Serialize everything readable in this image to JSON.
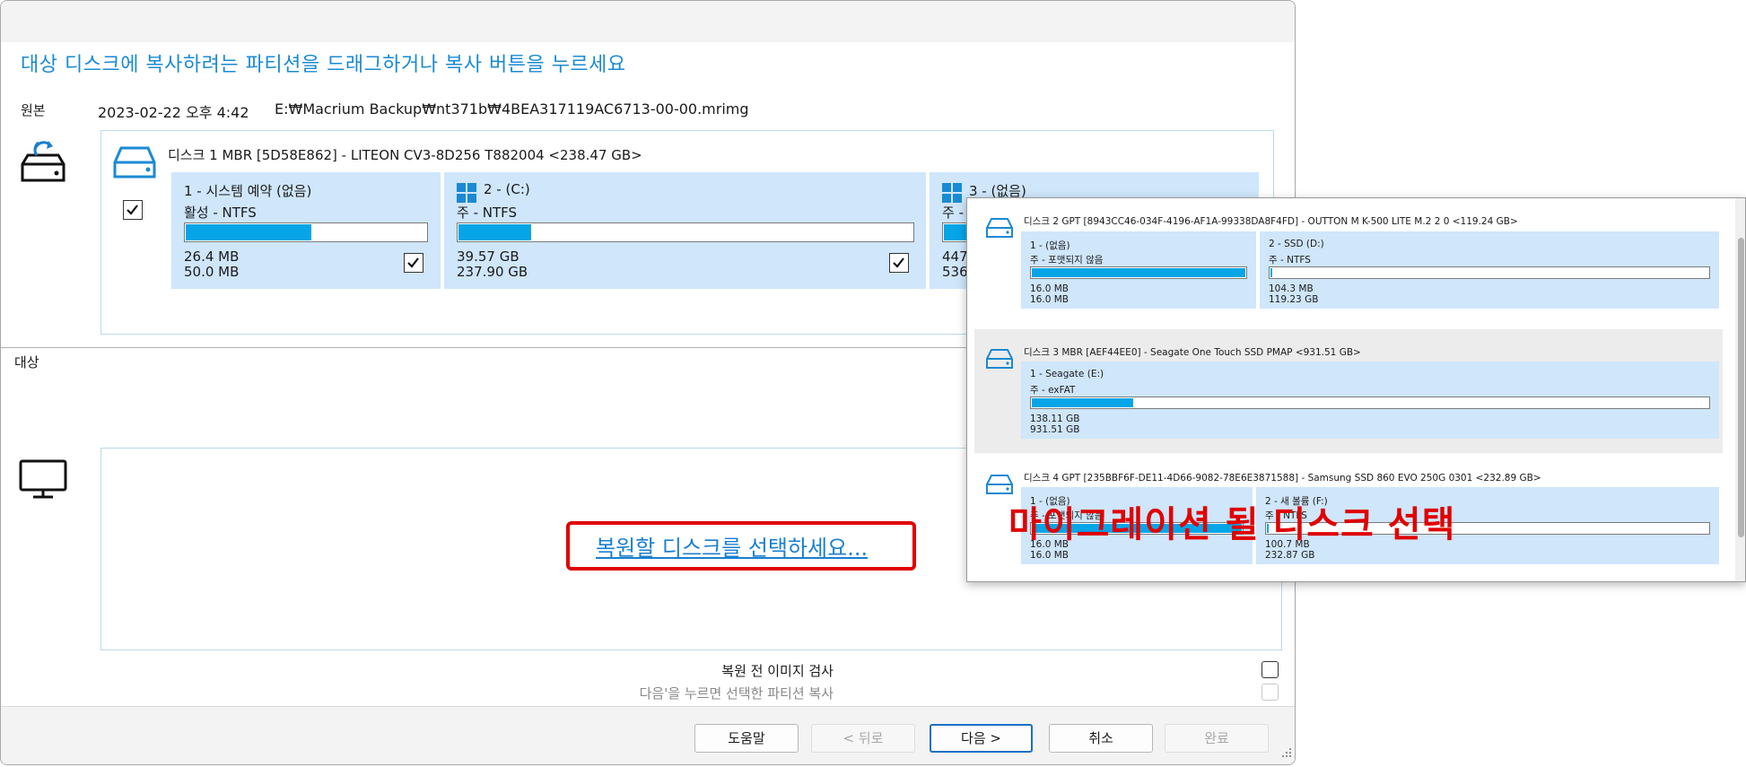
{
  "dialog": {
    "headline": "대상 디스크에 복사하려는 파티션을 드래그하거나 복사 버튼을 누르세요",
    "source": {
      "label": "원본",
      "date": "2023-02-22 오후 4:42",
      "path": "E:₩Macrium Backup₩nt371b₩4BEA317119AC6713-00-00.mrimg"
    },
    "source_disk": {
      "title": "디스크 1 MBR [5D58E862] - LITEON CV3-8D256 T882004  <238.47 GB>",
      "partitions": [
        {
          "name": "1 - 시스템 예약 (없음)",
          "fs": "활성 - NTFS",
          "used": "26.4 MB",
          "total": "50.0 MB",
          "fill": 0.52,
          "checked": true
        },
        {
          "name": "2 -  (C:)",
          "fs": "주 - NTFS",
          "used": "39.57 GB",
          "total": "237.90 GB",
          "fill": 0.16,
          "checked": true
        },
        {
          "name": "3 -  (없음)",
          "fs": "주 -",
          "used": "447.",
          "total": "536.",
          "fill": 0.3
        }
      ]
    },
    "target": {
      "label": "대상",
      "select_link": "복원할 디스크를 선택하세요..."
    },
    "options": {
      "verify": "복원 전 이미지 검사",
      "copy_selected": "다음'을 누르면 선택한 파티션 복사"
    },
    "buttons": {
      "help": "도움말",
      "back": "< 뒤로",
      "next": "다음 >",
      "cancel": "취소",
      "finish": "완료"
    }
  },
  "popup": {
    "disks": [
      {
        "title": "디스크 2 GPT [8943CC46-034F-4196-AF1A-99338DA8F4FD] - OUTTON M K-500 LITE M.2 2 0  <119.24 GB>",
        "partitions": [
          {
            "name": "1 - (없음)",
            "fs": "주 - 포맷되지 않음",
            "used": "16.0 MB",
            "total": "16.0 MB",
            "fill": 1.0
          },
          {
            "name": "2 - SSD (D:)",
            "fs": "주 - NTFS",
            "used": "104.3 MB",
            "total": "119.23 GB",
            "fill": 0.0
          }
        ]
      },
      {
        "title": "디스크 3 MBR [AEF44EE0] - Seagate  One Touch SSD PMAP  <931.51 GB>",
        "partitions": [
          {
            "name": "1 - Seagate (E:)",
            "fs": "주 - exFAT",
            "used": "138.11 GB",
            "total": "931.51 GB",
            "fill": 0.15
          }
        ]
      },
      {
        "title": "디스크 4 GPT [235BBF6F-DE11-4D66-9082-78E6E3871588] - Samsung  SSD 860 EVO 250G 0301  <232.89 GB>",
        "partitions": [
          {
            "name": "1 - (없음)",
            "fs": "주 - 포맷되지 않음",
            "used": "16.0 MB",
            "total": "16.0 MB",
            "fill": 1.0
          },
          {
            "name": "2 - 새 볼륨 (F:)",
            "fs": "주 - NTFS",
            "used": "100.7 MB",
            "total": "232.87 GB",
            "fill": 0.0
          }
        ]
      }
    ]
  },
  "annotation": {
    "text": "마이그레이션 될 디스크 선택"
  },
  "colors": {
    "accent": "#1a8ad4",
    "partition_bg": "#cfe6fb",
    "bar_fill": "#06a5e8",
    "highlight_red": "#e00000"
  }
}
